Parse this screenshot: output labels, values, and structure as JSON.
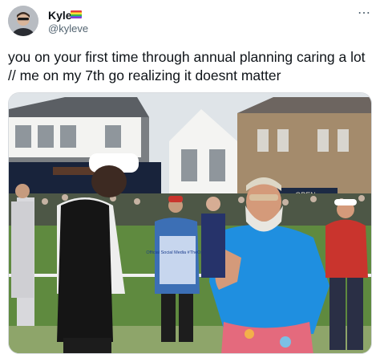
{
  "tweet": {
    "author": {
      "name": "Kyle",
      "handle": "@kyleve",
      "badge": "rainbow-flag-emoji"
    },
    "more_icon": "⋯",
    "text": "you on your first time through annual planning caring a lot // me on my 7th go realizing it doesnt matter"
  },
  "photo": {
    "signs": [
      "OPEN",
      "Official Social Media #TheOpen"
    ]
  },
  "colors": {
    "name_text": "#0f1419",
    "handle_text": "#536471",
    "shirt_blue": "#1f8fe0",
    "shirt_red": "#c9342d"
  }
}
